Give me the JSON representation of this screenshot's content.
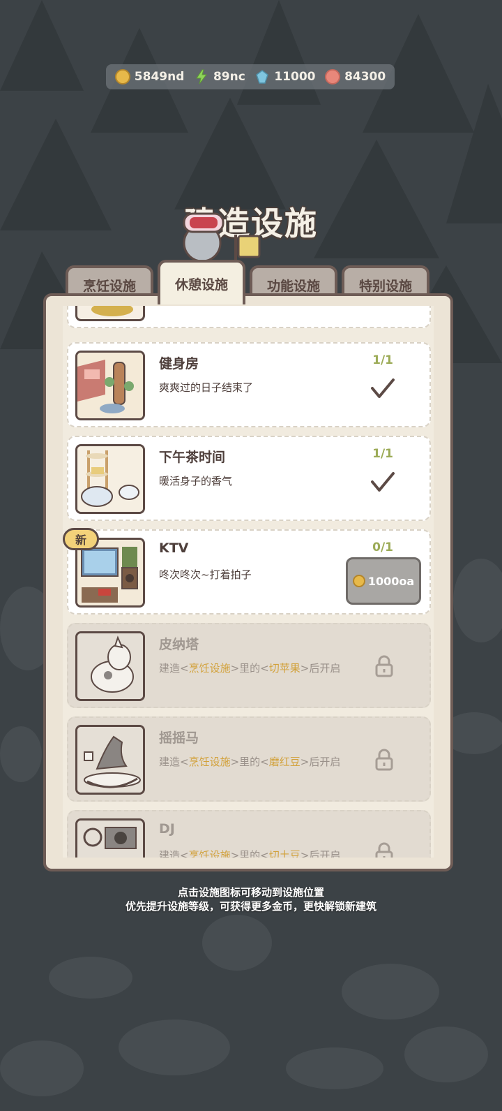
{
  "currency": [
    {
      "icon": "coin-icon",
      "value": "5849nd"
    },
    {
      "icon": "lightning-icon",
      "value": "89nc"
    },
    {
      "icon": "gem-icon",
      "value": "11000"
    },
    {
      "icon": "shell-icon",
      "value": "84300"
    }
  ],
  "title": "建造设施",
  "tabs": [
    {
      "label": "烹饪设施",
      "active": false
    },
    {
      "label": "休憩设施",
      "active": true
    },
    {
      "label": "功能设施",
      "active": false
    },
    {
      "label": "特别设施",
      "active": false
    }
  ],
  "items": [
    {
      "name": "健身房",
      "desc": "爽爽过的日子结束了",
      "count": "1/1",
      "status": "done"
    },
    {
      "name": "下午茶时间",
      "desc": "暖活身子的香气",
      "count": "1/1",
      "status": "done"
    },
    {
      "name": "KTV",
      "desc": "咚次咚次~打着拍子",
      "count": "0/1",
      "status": "buy",
      "price": "1000oa",
      "badge": "新"
    },
    {
      "name": "皮纳塔",
      "desc_pre": "建造<",
      "desc_hl1": "烹饪设施",
      "desc_mid": ">里的<",
      "desc_hl2": "切苹果",
      "desc_post": ">后开启",
      "status": "locked"
    },
    {
      "name": "摇摇马",
      "desc_pre": "建造<",
      "desc_hl1": "烹饪设施",
      "desc_mid": ">里的<",
      "desc_hl2": "磨红豆",
      "desc_post": ">后开启",
      "status": "locked"
    },
    {
      "name": "DJ",
      "desc_pre": "建造<",
      "desc_hl1": "烹饪设施",
      "desc_mid": ">里的<",
      "desc_hl2": "切土豆",
      "desc_post": ">后开启",
      "status": "locked"
    }
  ],
  "hint": {
    "line1": "点击设施图标可移动到设施位置",
    "line2": "优先提升设施等级，可获得更多金币，更快解锁新建筑"
  }
}
